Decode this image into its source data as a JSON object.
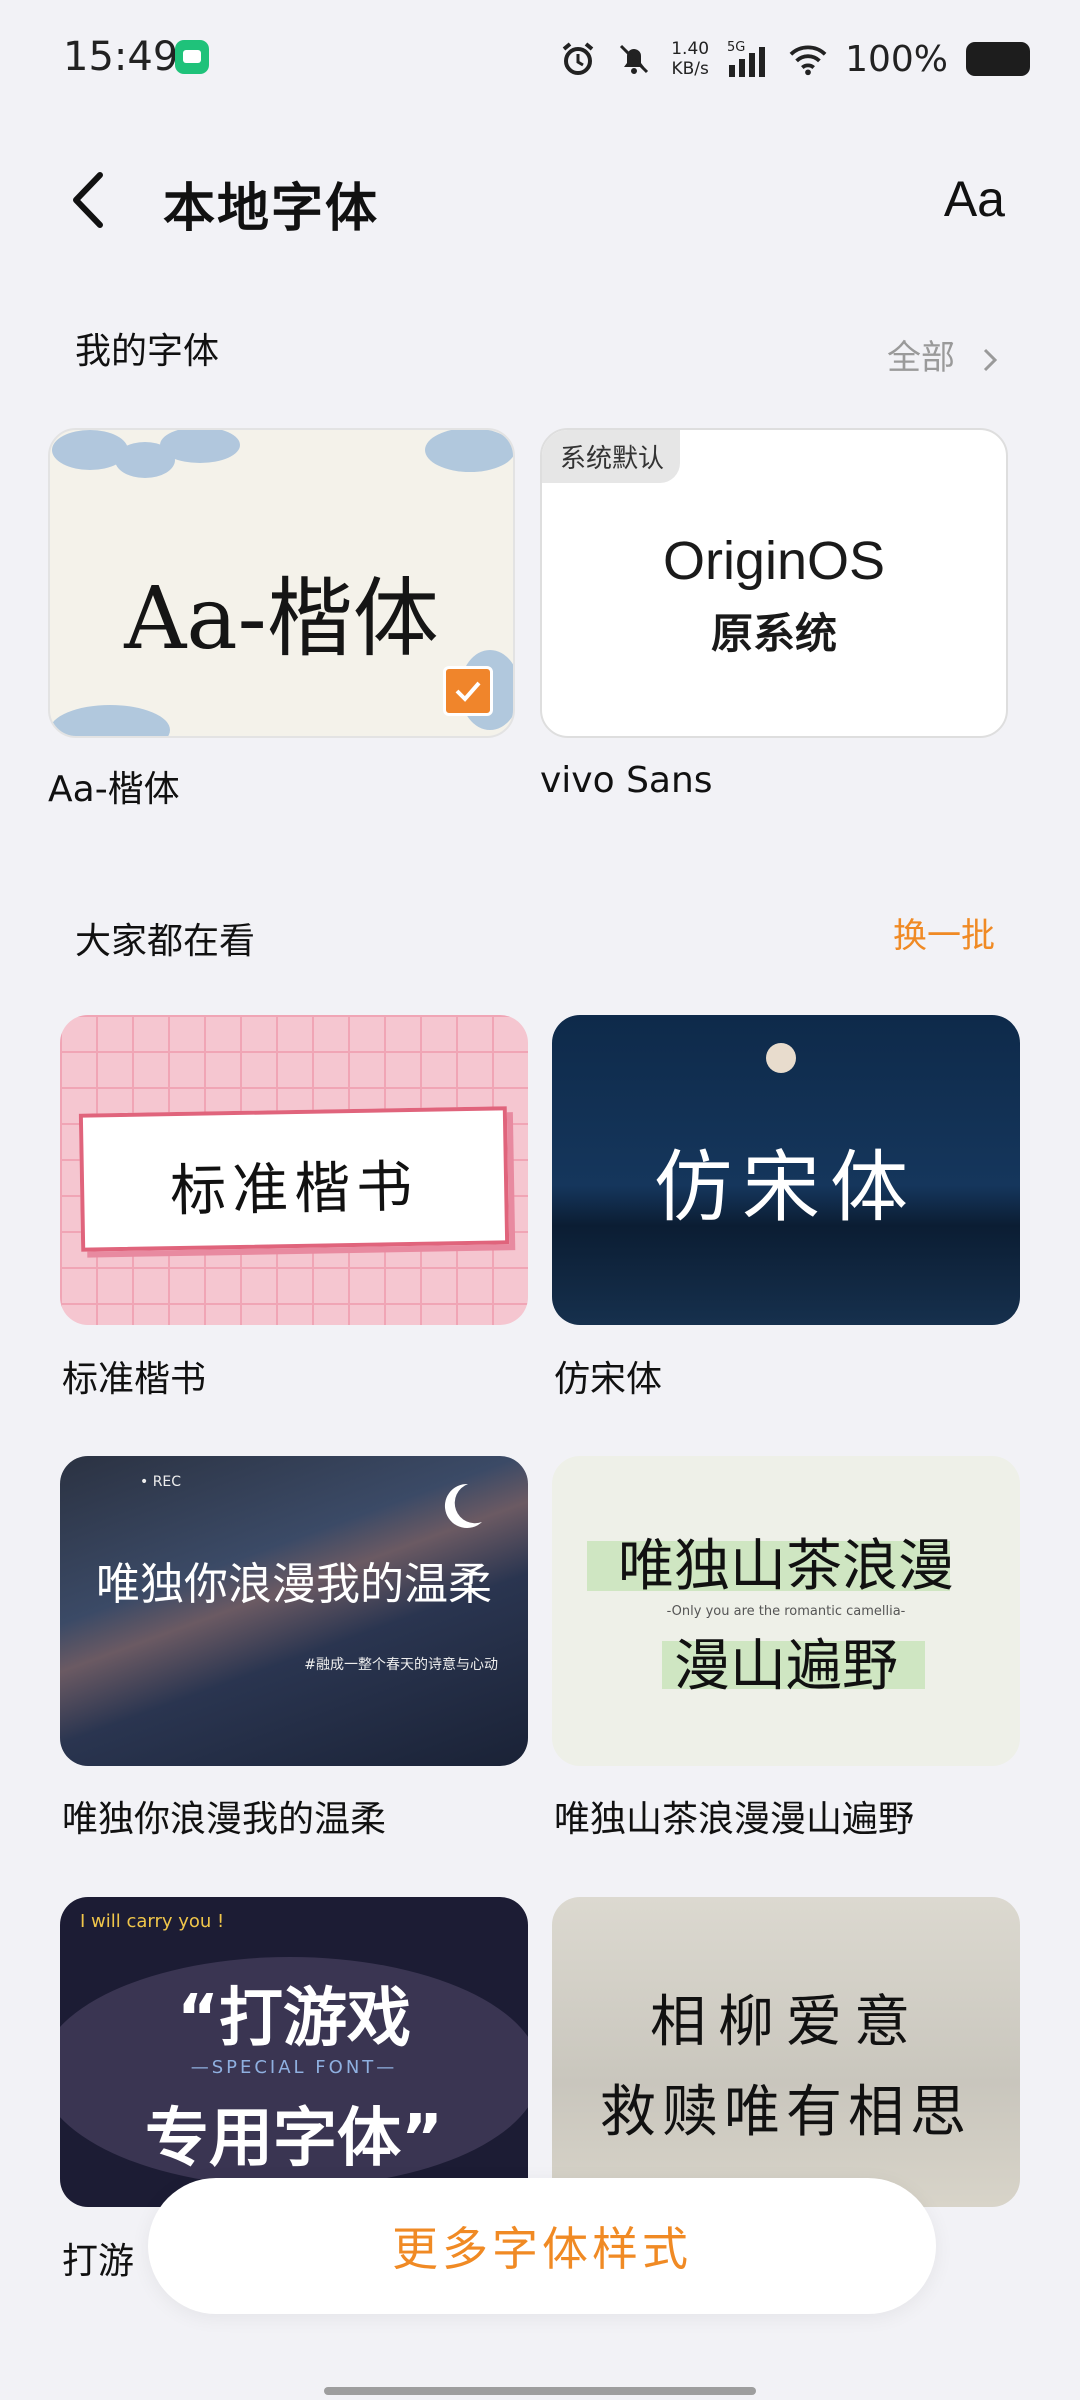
{
  "status_bar": {
    "time": "15:49",
    "net_speed_value": "1.40",
    "net_speed_unit": "KB/s",
    "signal": "5G",
    "battery": "100%"
  },
  "header": {
    "title": "本地字体",
    "font_size_icon": "Aa"
  },
  "my_fonts": {
    "title": "我的字体",
    "all_link": "全部",
    "items": [
      {
        "preview": "Aa-楷体",
        "label": "Aa-楷体",
        "selected": true
      },
      {
        "badge": "系统默认",
        "preview_line1": "OriginOS",
        "preview_line2": "原系统",
        "label": "vivo Sans"
      }
    ]
  },
  "popular": {
    "title": "大家都在看",
    "refresh": "换一批",
    "items": [
      {
        "preview": "标准楷书",
        "label": "标准楷书"
      },
      {
        "preview": "仿宋体",
        "label": "仿宋体"
      },
      {
        "preview": "唯独你浪漫我的温柔",
        "preview_sub": "#融成一整个春天的诗意与心动",
        "label": "唯独你浪漫我的温柔"
      },
      {
        "preview_line1": "唯独山茶浪漫",
        "preview_line2": "漫山遍野",
        "preview_sub": "-Only you are the romantic camellia-",
        "label": "唯独山茶浪漫漫山遍野"
      },
      {
        "preview_top": "I will carry you !",
        "preview_line1": "“打游戏",
        "preview_sub": "—SPECIAL FONT—",
        "preview_line2": "专用字体”",
        "label": "打游"
      },
      {
        "preview_line1": "相柳爱意",
        "preview_line2": "救赎唯有相思"
      }
    ]
  },
  "more_button": "更多字体样式",
  "colors": {
    "accent": "#f08a24",
    "background": "#f2f2f6"
  }
}
